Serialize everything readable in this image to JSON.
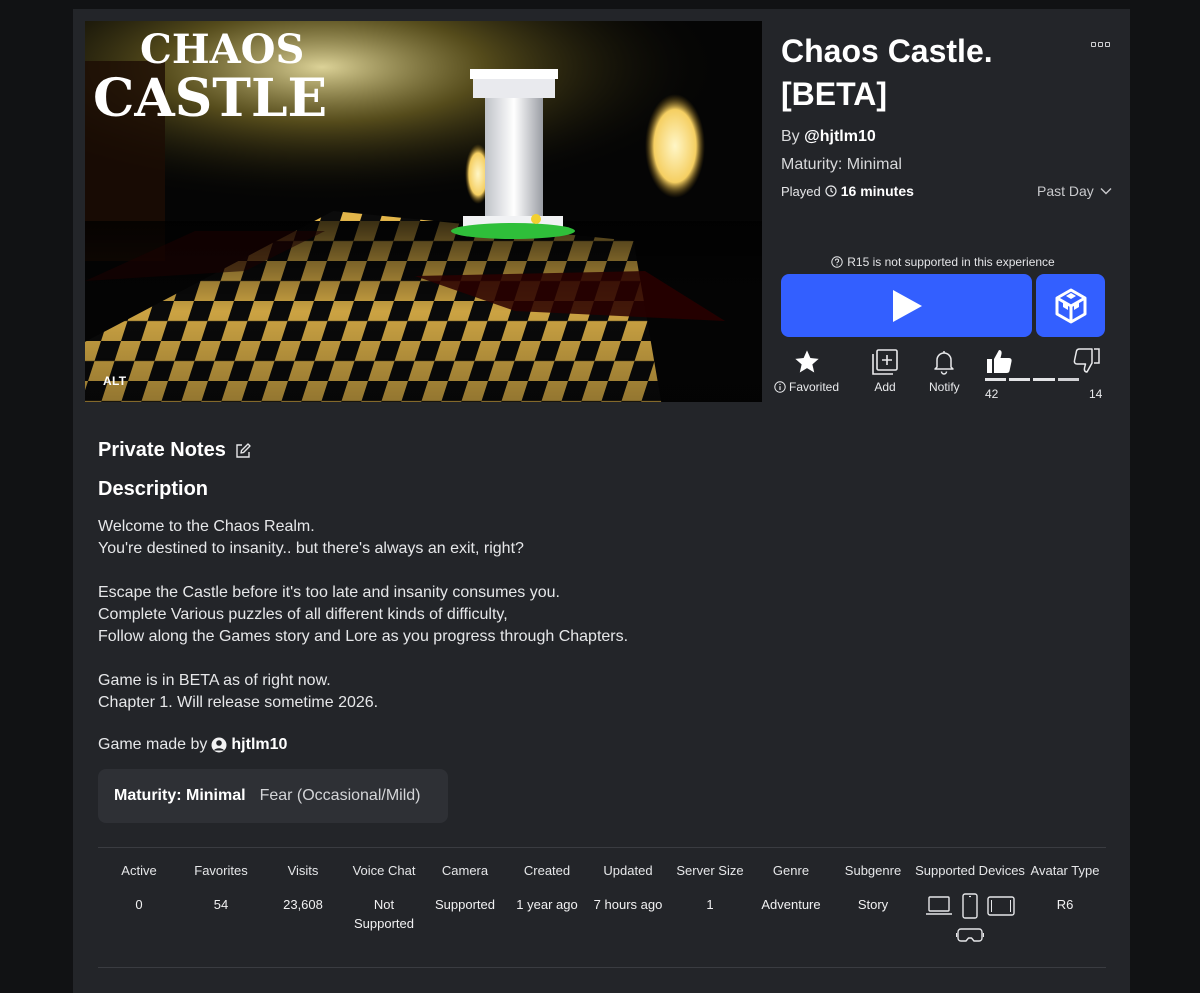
{
  "game": {
    "title": "Chaos Castle. [BETA]",
    "by_prefix": "By",
    "creator": "@hjtlm10",
    "maturity_line": "Maturity: Minimal",
    "played_label": "Played",
    "played_duration": "16 minutes",
    "period": "Past Day",
    "thumbnail_logo_line1": "CHAOS",
    "thumbnail_logo_line2": "CASTLE",
    "thumbnail_alt": "ALT"
  },
  "play": {
    "notice": "R15 is not supported in this experience"
  },
  "actions": {
    "favorite": "Favorited",
    "add": "Add",
    "notify": "Notify"
  },
  "votes": {
    "up": "42",
    "down": "14"
  },
  "content": {
    "private_notes": "Private Notes",
    "description_heading": "Description",
    "description_lines": [
      "Welcome to the Chaos Realm.",
      "You're destined to insanity.. but there's always an exit, right?",
      "",
      "Escape the Castle before it's too late and insanity consumes you.",
      "Complete Various puzzles of all different kinds of difficulty,",
      "Follow along the Games story and Lore as you progress through Chapters.",
      "",
      "Game is in BETA as of right now.",
      "Chapter 1. Will release sometime 2026."
    ],
    "made_by_prefix": "Game made by",
    "made_by_user": "hjtlm10",
    "maturity_key": "Maturity: Minimal",
    "maturity_value": "Fear (Occasional/Mild)"
  },
  "stats": [
    {
      "label": "Active",
      "value": "0"
    },
    {
      "label": "Favorites",
      "value": "54"
    },
    {
      "label": "Visits",
      "value": "23,608"
    },
    {
      "label": "Voice Chat",
      "value": "Not Supported"
    },
    {
      "label": "Camera",
      "value": "Supported"
    },
    {
      "label": "Created",
      "value": "1 year ago"
    },
    {
      "label": "Updated",
      "value": "7 hours ago"
    },
    {
      "label": "Server Size",
      "value": "1"
    },
    {
      "label": "Genre",
      "value": "Adventure"
    },
    {
      "label": "Subgenre",
      "value": "Story"
    },
    {
      "label": "Supported Devices",
      "value": ""
    },
    {
      "label": "Avatar Type",
      "value": "R6"
    }
  ],
  "devices": [
    "computer-icon",
    "phone-icon",
    "tablet-icon",
    "vr-headset-icon"
  ],
  "colors": {
    "accent": "#335fff",
    "panel": "#232529",
    "background": "#111214"
  }
}
